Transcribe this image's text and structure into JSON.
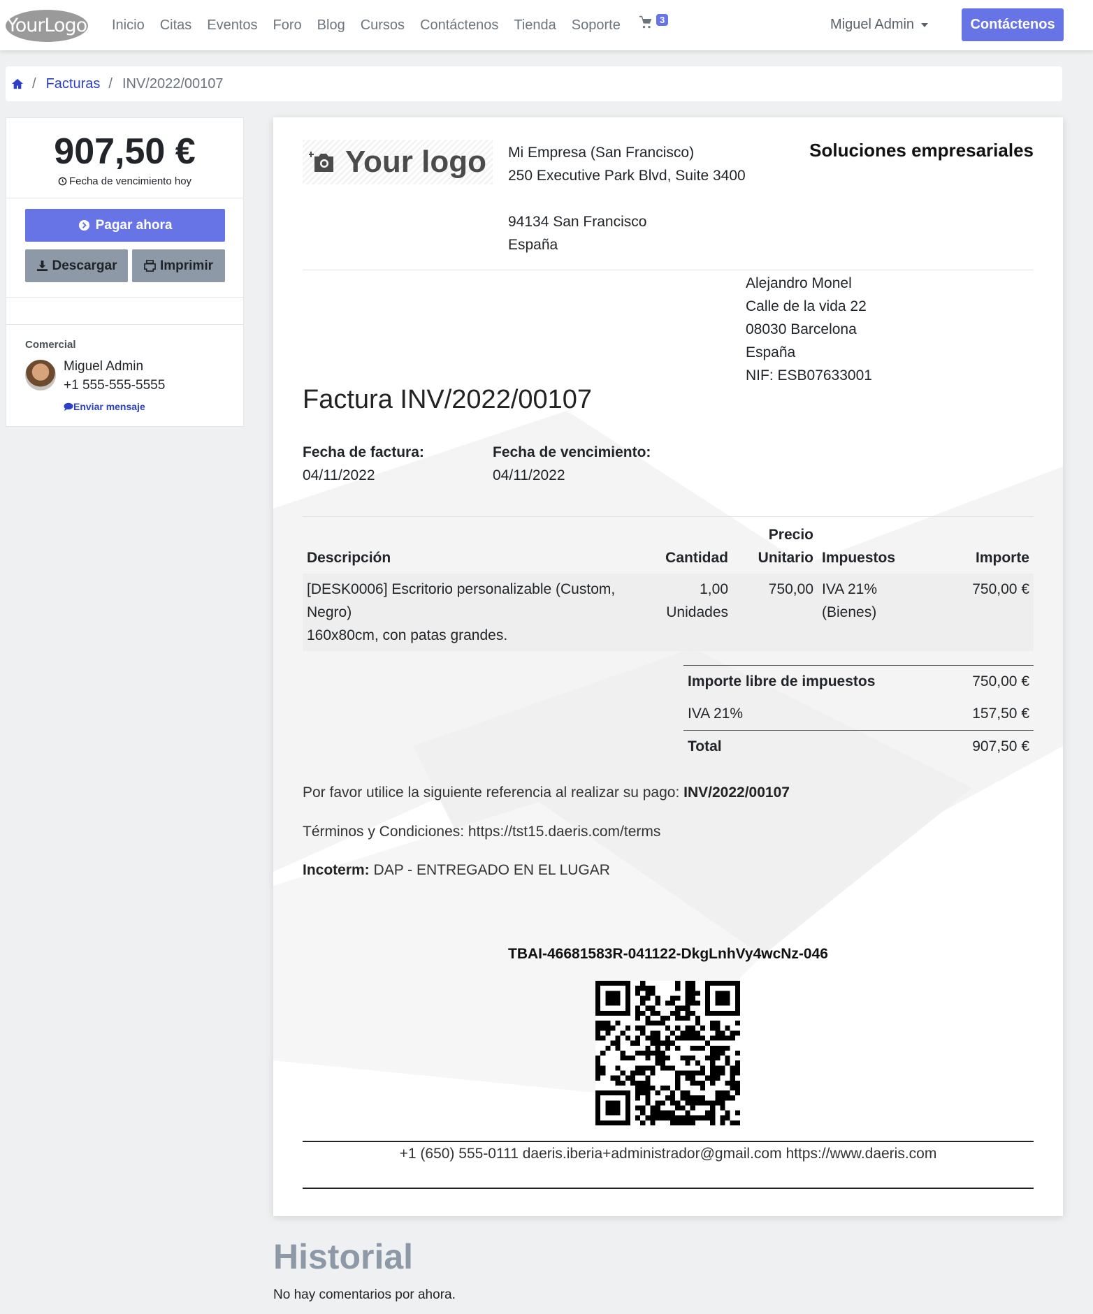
{
  "nav": {
    "brand": "YourLogo",
    "links": [
      "Inicio",
      "Citas",
      "Eventos",
      "Foro",
      "Blog",
      "Cursos",
      "Contáctenos",
      "Tienda",
      "Soporte"
    ],
    "cart_count": "3",
    "user": "Miguel Admin",
    "contact_button": "Contáctenos"
  },
  "breadcrumb": {
    "link": "Facturas",
    "current": "INV/2022/00107",
    "separator": "/"
  },
  "sidebar": {
    "amount": "907,50 €",
    "due_text": "Fecha de vencimiento hoy",
    "pay_button": "Pagar ahora",
    "download_button": "Descargar",
    "print_button": "Imprimir",
    "salesperson_label": "Comercial",
    "salesperson_name": "Miguel Admin",
    "salesperson_phone": "+1 555-555-5555",
    "send_message": "Enviar mensaje"
  },
  "invoice": {
    "logo_text": "Your logo",
    "company": {
      "name": "Mi Empresa (San Francisco)",
      "street": "250 Executive Park Blvd, Suite 3400",
      "city": "94134 San Francisco",
      "country": "España"
    },
    "tagline": "Soluciones empresariales",
    "client": {
      "name": "Alejandro Monel",
      "street": "Calle de la vida 22",
      "city": "08030 Barcelona",
      "country": "España",
      "vat": "NIF: ESB07633001"
    },
    "title": "Factura INV/2022/00107",
    "invoice_date_label": "Fecha de factura:",
    "invoice_date": "04/11/2022",
    "due_date_label": "Fecha de vencimiento:",
    "due_date": "04/11/2022",
    "columns": {
      "description": "Descripción",
      "quantity": "Cantidad",
      "unit_price_1": "Precio",
      "unit_price_2": "Unitario",
      "taxes": "Impuestos",
      "amount": "Importe"
    },
    "lines": [
      {
        "description_1": "[DESK0006] Escritorio personalizable (Custom,",
        "description_2": "Negro)",
        "description_3": "160x80cm, con patas grandes.",
        "quantity": "1,00",
        "uom": "Unidades",
        "unit_price": "750,00",
        "tax_1": "IVA 21%",
        "tax_2": "(Bienes)",
        "amount": "750,00 €"
      }
    ],
    "totals": {
      "untaxed_label": "Importe libre de impuestos",
      "untaxed": "750,00 €",
      "tax_label": "IVA 21%",
      "tax": "157,50 €",
      "total_label": "Total",
      "total": "907,50 €"
    },
    "payment_ref_text": "Por favor utilice la siguiente referencia al realizar su pago:",
    "payment_ref": "INV/2022/00107",
    "terms": "Términos y Condiciones: https://tst15.daeris.com/terms",
    "incoterm_label": "Incoterm:",
    "incoterm": "DAP - ENTREGADO EN EL LUGAR",
    "tbai": "TBAI-46681583R-041122-DkgLnhVy4wcNz-046",
    "footer": "+1 (650) 555-0111 daeris.iberia+administrador@gmail.com https://www.daeris.com"
  },
  "history": {
    "title": "Historial",
    "empty": "No hay comentarios por ahora."
  },
  "colors": {
    "primary": "#6674e6",
    "secondary": "#8d99a6",
    "link": "#2b3fc7"
  }
}
